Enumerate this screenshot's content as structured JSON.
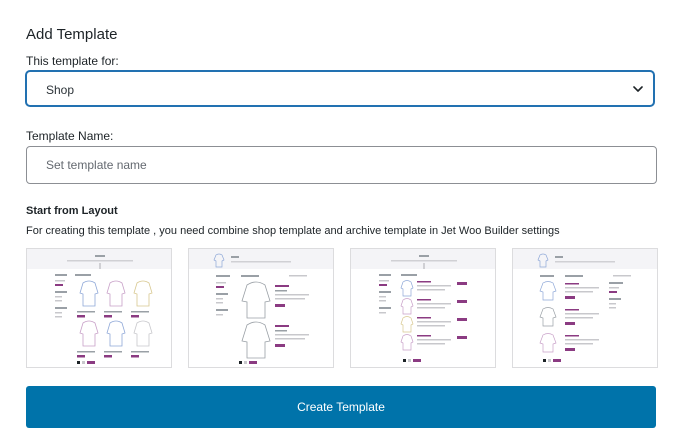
{
  "header": {
    "title": "Add Template"
  },
  "template_for": {
    "label": "This template for:",
    "selected": "Shop"
  },
  "template_name": {
    "label": "Template Name:",
    "value": "",
    "placeholder": "Set template name"
  },
  "layout": {
    "heading": "Start from Layout",
    "description": "For creating this template , you need combine shop template and archive template in Jet Woo Builder settings",
    "options": [
      {
        "variant": "grid-with-sidebar"
      },
      {
        "variant": "list-large-image"
      },
      {
        "variant": "list-with-sidebar"
      },
      {
        "variant": "list-compact"
      }
    ]
  },
  "actions": {
    "create_label": "Create Template"
  },
  "colors": {
    "accent": "#0073aa",
    "focus_border": "#2271b1",
    "thumb_purple": "#8b3b82",
    "border": "#8c8f94"
  },
  "icons": {
    "select_arrow": "chevron-down-icon"
  }
}
